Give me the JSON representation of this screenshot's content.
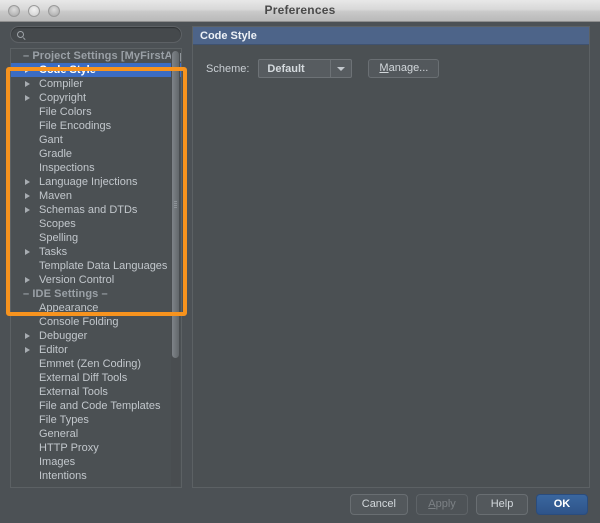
{
  "window": {
    "title": "Preferences",
    "traffic_lights": [
      "close-button",
      "minimize-button",
      "zoom-button"
    ]
  },
  "search": {
    "value": "",
    "placeholder": "",
    "icon": "search-icon"
  },
  "sidebar": {
    "items": [
      {
        "label": "Project Settings [MyFirstApp]",
        "type": "group",
        "expandable": false,
        "selected": false
      },
      {
        "label": "Code Style",
        "type": "item",
        "expandable": true,
        "selected": true
      },
      {
        "label": "Compiler",
        "type": "item",
        "expandable": true,
        "selected": false
      },
      {
        "label": "Copyright",
        "type": "item",
        "expandable": true,
        "selected": false
      },
      {
        "label": "File Colors",
        "type": "item",
        "expandable": false,
        "selected": false
      },
      {
        "label": "File Encodings",
        "type": "item",
        "expandable": false,
        "selected": false
      },
      {
        "label": "Gant",
        "type": "item",
        "expandable": false,
        "selected": false
      },
      {
        "label": "Gradle",
        "type": "item",
        "expandable": false,
        "selected": false
      },
      {
        "label": "Inspections",
        "type": "item",
        "expandable": false,
        "selected": false
      },
      {
        "label": "Language Injections",
        "type": "item",
        "expandable": true,
        "selected": false
      },
      {
        "label": "Maven",
        "type": "item",
        "expandable": true,
        "selected": false
      },
      {
        "label": "Schemas and DTDs",
        "type": "item",
        "expandable": true,
        "selected": false
      },
      {
        "label": "Scopes",
        "type": "item",
        "expandable": false,
        "selected": false
      },
      {
        "label": "Spelling",
        "type": "item",
        "expandable": false,
        "selected": false
      },
      {
        "label": "Tasks",
        "type": "item",
        "expandable": true,
        "selected": false
      },
      {
        "label": "Template Data Languages",
        "type": "item",
        "expandable": false,
        "selected": false
      },
      {
        "label": "Version Control",
        "type": "item",
        "expandable": true,
        "selected": false
      },
      {
        "label": "IDE Settings",
        "type": "group",
        "expandable": false,
        "selected": false
      },
      {
        "label": "Appearance",
        "type": "item",
        "expandable": false,
        "selected": false
      },
      {
        "label": "Console Folding",
        "type": "item",
        "expandable": false,
        "selected": false
      },
      {
        "label": "Debugger",
        "type": "item",
        "expandable": true,
        "selected": false
      },
      {
        "label": "Editor",
        "type": "item",
        "expandable": true,
        "selected": false
      },
      {
        "label": "Emmet (Zen Coding)",
        "type": "item",
        "expandable": false,
        "selected": false
      },
      {
        "label": "External Diff Tools",
        "type": "item",
        "expandable": false,
        "selected": false
      },
      {
        "label": "External Tools",
        "type": "item",
        "expandable": false,
        "selected": false
      },
      {
        "label": "File and Code Templates",
        "type": "item",
        "expandable": false,
        "selected": false
      },
      {
        "label": "File Types",
        "type": "item",
        "expandable": false,
        "selected": false
      },
      {
        "label": "General",
        "type": "item",
        "expandable": false,
        "selected": false
      },
      {
        "label": "HTTP Proxy",
        "type": "item",
        "expandable": false,
        "selected": false
      },
      {
        "label": "Images",
        "type": "item",
        "expandable": false,
        "selected": false
      },
      {
        "label": "Intentions",
        "type": "item",
        "expandable": false,
        "selected": false
      }
    ]
  },
  "main": {
    "header_title": "Code Style",
    "scheme_label": "Scheme:",
    "scheme_value": "Default",
    "manage_label_prefix": "M",
    "manage_label_rest": "anage..."
  },
  "footer": {
    "cancel": "Cancel",
    "apply_prefix": "A",
    "apply_rest": "pply",
    "help": "Help",
    "ok": "OK"
  },
  "annotation": {
    "color": "#f7931e",
    "target": "project-settings-group"
  },
  "colors": {
    "selection_blue": "#3b6cc3",
    "header_blue": "#4d6489",
    "panel_bg": "#4b5053",
    "window_bg": "#4c5155",
    "accent_orange": "#f7931e",
    "primary_button": "#3a679f"
  }
}
